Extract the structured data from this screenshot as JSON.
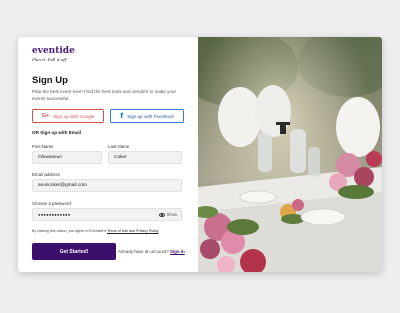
{
  "brand": {
    "name": "eventide",
    "tagline": "Plan it. Pull it off."
  },
  "heading": {
    "title": "Sign Up",
    "subtitle": "Plan the best event ever! Find the best tools and vendors to make your events successful."
  },
  "social": {
    "google_label": "Sign up with Google",
    "facebook_label": "Sign up with Facebook",
    "google_icon": "google-icon",
    "facebook_icon": "facebook-icon"
  },
  "divider_label": "OR Sign up with Email",
  "form": {
    "first_name": {
      "label": "First Name",
      "value": "Oluwaseun"
    },
    "last_name": {
      "label": "Last Name",
      "value": "Coker"
    },
    "email": {
      "label": "Email address",
      "value": "seuncoker@gmail.com"
    },
    "password": {
      "label": "Choose a password",
      "value": "●●●●●●●●●●●●",
      "toggle_label": "Show"
    }
  },
  "terms": {
    "prefix": "By clicking this button, you agree to Eventide's",
    "link": "Terms of Use and Privacy Policy"
  },
  "cta": {
    "label": "Get Started!"
  },
  "signin": {
    "prompt": "Already have an account?",
    "link": "Sign in"
  },
  "colors": {
    "brand_purple": "#3b0f6b",
    "google_red": "#d9534f",
    "facebook_blue": "#1877f2",
    "field_bg": "#f2f2f3"
  }
}
